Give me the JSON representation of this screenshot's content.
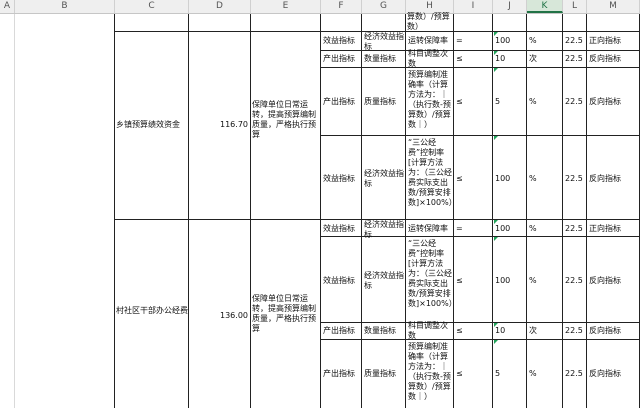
{
  "col_headers": [
    "A",
    "B",
    "C",
    "D",
    "E",
    "F",
    "G",
    "H",
    "I",
    "J",
    "K",
    "L",
    "M"
  ],
  "top_fragment": "算数）/预算数）",
  "block1": {
    "project": "乡镇预算绩效资金",
    "amount": "116.70",
    "goal": "保障单位日常运转，提高预算编制质量，严格执行预算",
    "rows": [
      {
        "first": "效益指标",
        "second": "经济效益指标",
        "third": "运转保障率",
        "op": "=",
        "val": "100",
        "unit": "%",
        "weight": "22.5",
        "dir": "正向指标"
      },
      {
        "first": "产出指标",
        "second": "数量指标",
        "third": "科目调整次数",
        "op": "≤",
        "val": "10",
        "unit": "次",
        "weight": "22.5",
        "dir": "反向指标"
      },
      {
        "first": "产出指标",
        "second": "质量指标",
        "third": "预算编制准确率（计算方法为：｜（执行数-预算数）/预算数｜）",
        "op": "≤",
        "val": "5",
        "unit": "%",
        "weight": "22.5",
        "dir": "反向指标"
      },
      {
        "first": "效益指标",
        "second": "经济效益指标",
        "third": "“三公经费”控制率[计算方法为：（三公经费实际支出数/预算安排数]×100%）",
        "op": "≤",
        "val": "100",
        "unit": "%",
        "weight": "22.5",
        "dir": "反向指标"
      }
    ]
  },
  "block2": {
    "project": "村社区干部办公经费",
    "amount": "136.00",
    "goal": "保障单位日常运转，提高预算编制质量，严格执行预算",
    "rows": [
      {
        "first": "效益指标",
        "second": "经济效益指标",
        "third": "运转保障率",
        "op": "=",
        "val": "100",
        "unit": "%",
        "weight": "22.5",
        "dir": "正向指标"
      },
      {
        "first": "效益指标",
        "second": "经济效益指标",
        "third": "“三公经费”控制率[计算方法为：（三公经费实际支出数/预算安排数]×100%）",
        "op": "≤",
        "val": "100",
        "unit": "%",
        "weight": "22.5",
        "dir": "反向指标"
      },
      {
        "first": "产出指标",
        "second": "数量指标",
        "third": "科目调整次数",
        "op": "≤",
        "val": "10",
        "unit": "次",
        "weight": "22.5",
        "dir": "反向指标"
      },
      {
        "first": "产出指标",
        "second": "质量指标",
        "third": "预算编制准确率（计算方法为：｜（执行数-预算数）/预算数｜）",
        "op": "≤",
        "val": "5",
        "unit": "%",
        "weight": "22.5",
        "dir": "反向指标"
      }
    ]
  }
}
